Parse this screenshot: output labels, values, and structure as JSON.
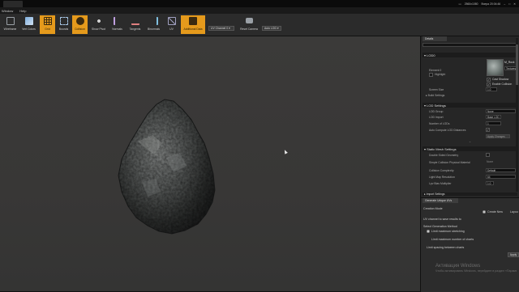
{
  "window": {
    "tray_resolution": "2560x1080",
    "tray_clock": "Вчера 20:04:46"
  },
  "menu": {
    "items": [
      "Window",
      "Help"
    ]
  },
  "toolbar": {
    "buttons": [
      {
        "label": "Wireframe",
        "icon": "wireframe-icon",
        "active": false,
        "color": "#9aa0a6"
      },
      {
        "label": "Vert Colors",
        "icon": "vert-colors-icon",
        "active": false,
        "color": "#7fb0e0"
      },
      {
        "label": "Grid",
        "icon": "grid-icon",
        "active": true,
        "color": "#3a2a10"
      },
      {
        "label": "Bounds",
        "icon": "bounds-icon",
        "active": false,
        "color": "#a8c8e8"
      },
      {
        "label": "Collision",
        "icon": "collision-icon",
        "active": true,
        "color": "#3a2a10"
      },
      {
        "label": "Show Pivot",
        "icon": "pivot-icon",
        "active": false,
        "color": "#9aa0a6"
      },
      {
        "label": "Normals",
        "icon": "normals-icon",
        "active": false,
        "color": "#c0a0e0"
      },
      {
        "label": "Tangents",
        "icon": "tangents-icon",
        "active": false,
        "color": "#e08080"
      },
      {
        "label": "Binormals",
        "icon": "binormals-icon",
        "active": false,
        "color": "#80c0e0"
      },
      {
        "label": "UV",
        "icon": "uv-icon",
        "active": false,
        "color": "#a0a0c0"
      },
      {
        "label": "Additional Data",
        "icon": "additional-data-icon",
        "active": true,
        "color": "#3a2a10"
      }
    ],
    "uv_channel_dropdown": "UV Channel 0 ▾",
    "reset_camera_label": "Reset Camera",
    "lod_dropdown": "Auto LOD ▾"
  },
  "details": {
    "tab_label": "Details",
    "search_placeholder": "",
    "sections": {
      "lod0": "▾ LOD0",
      "lod_settings": "▾ LOD Settings",
      "static_mesh_settings": "▾ Static Mesh Settings",
      "imported": "▸ Import Settings"
    },
    "lod0": {
      "element": "Element 0",
      "highlight": "Highlight",
      "material_name": "M_Rock",
      "material_sub": "Textures",
      "cast_shadow": "Cast Shadow",
      "enable_collision": "Enable Collision",
      "screen_size": "Screen Size",
      "screen_size_value": "1.0",
      "build_settings": "▸ Build Settings"
    },
    "lod_settings": {
      "lod_group": "LOD Group",
      "lod_group_value": "None",
      "lod_import": "LOD Import",
      "lod_import_value": "Base LOD",
      "number_of_lods": "Number of LODs",
      "number_of_lods_value": "1",
      "auto_compute": "Auto Compute LOD Distances",
      "apply_changes": "Apply Changes"
    },
    "static_mesh": {
      "double_sided": "Double Sided Geometry",
      "simple_collision": "Simple Collision Physical Material",
      "simple_collision_value": "None",
      "collision_complexity": "Collision Complexity",
      "collision_complexity_value": "Default",
      "light_map_res": "Light Map Resolution",
      "light_map_res_value": "64",
      "lpv_bias": "Lpv Bias Multiplier",
      "lpv_bias_value": "1.0"
    }
  },
  "uv_panel": {
    "tab_label": "Generate Unique UVs",
    "creation_mode": "Creation Mode",
    "create_new": "Create New",
    "layout": "Layout",
    "uv_channel_text": "UV channel to save results to",
    "select_method": "Select Generation Method",
    "limit_stretching": "Limit maximum stretching",
    "limit_charts": "Limit maximum number of charts",
    "limit_spacing": "Limit spacing between charts",
    "apply": "Apply"
  },
  "watermark": {
    "line1": "Активация Windows",
    "line2": "Чтобы активировать Windows, перейдите в раздел «Параметры»."
  }
}
